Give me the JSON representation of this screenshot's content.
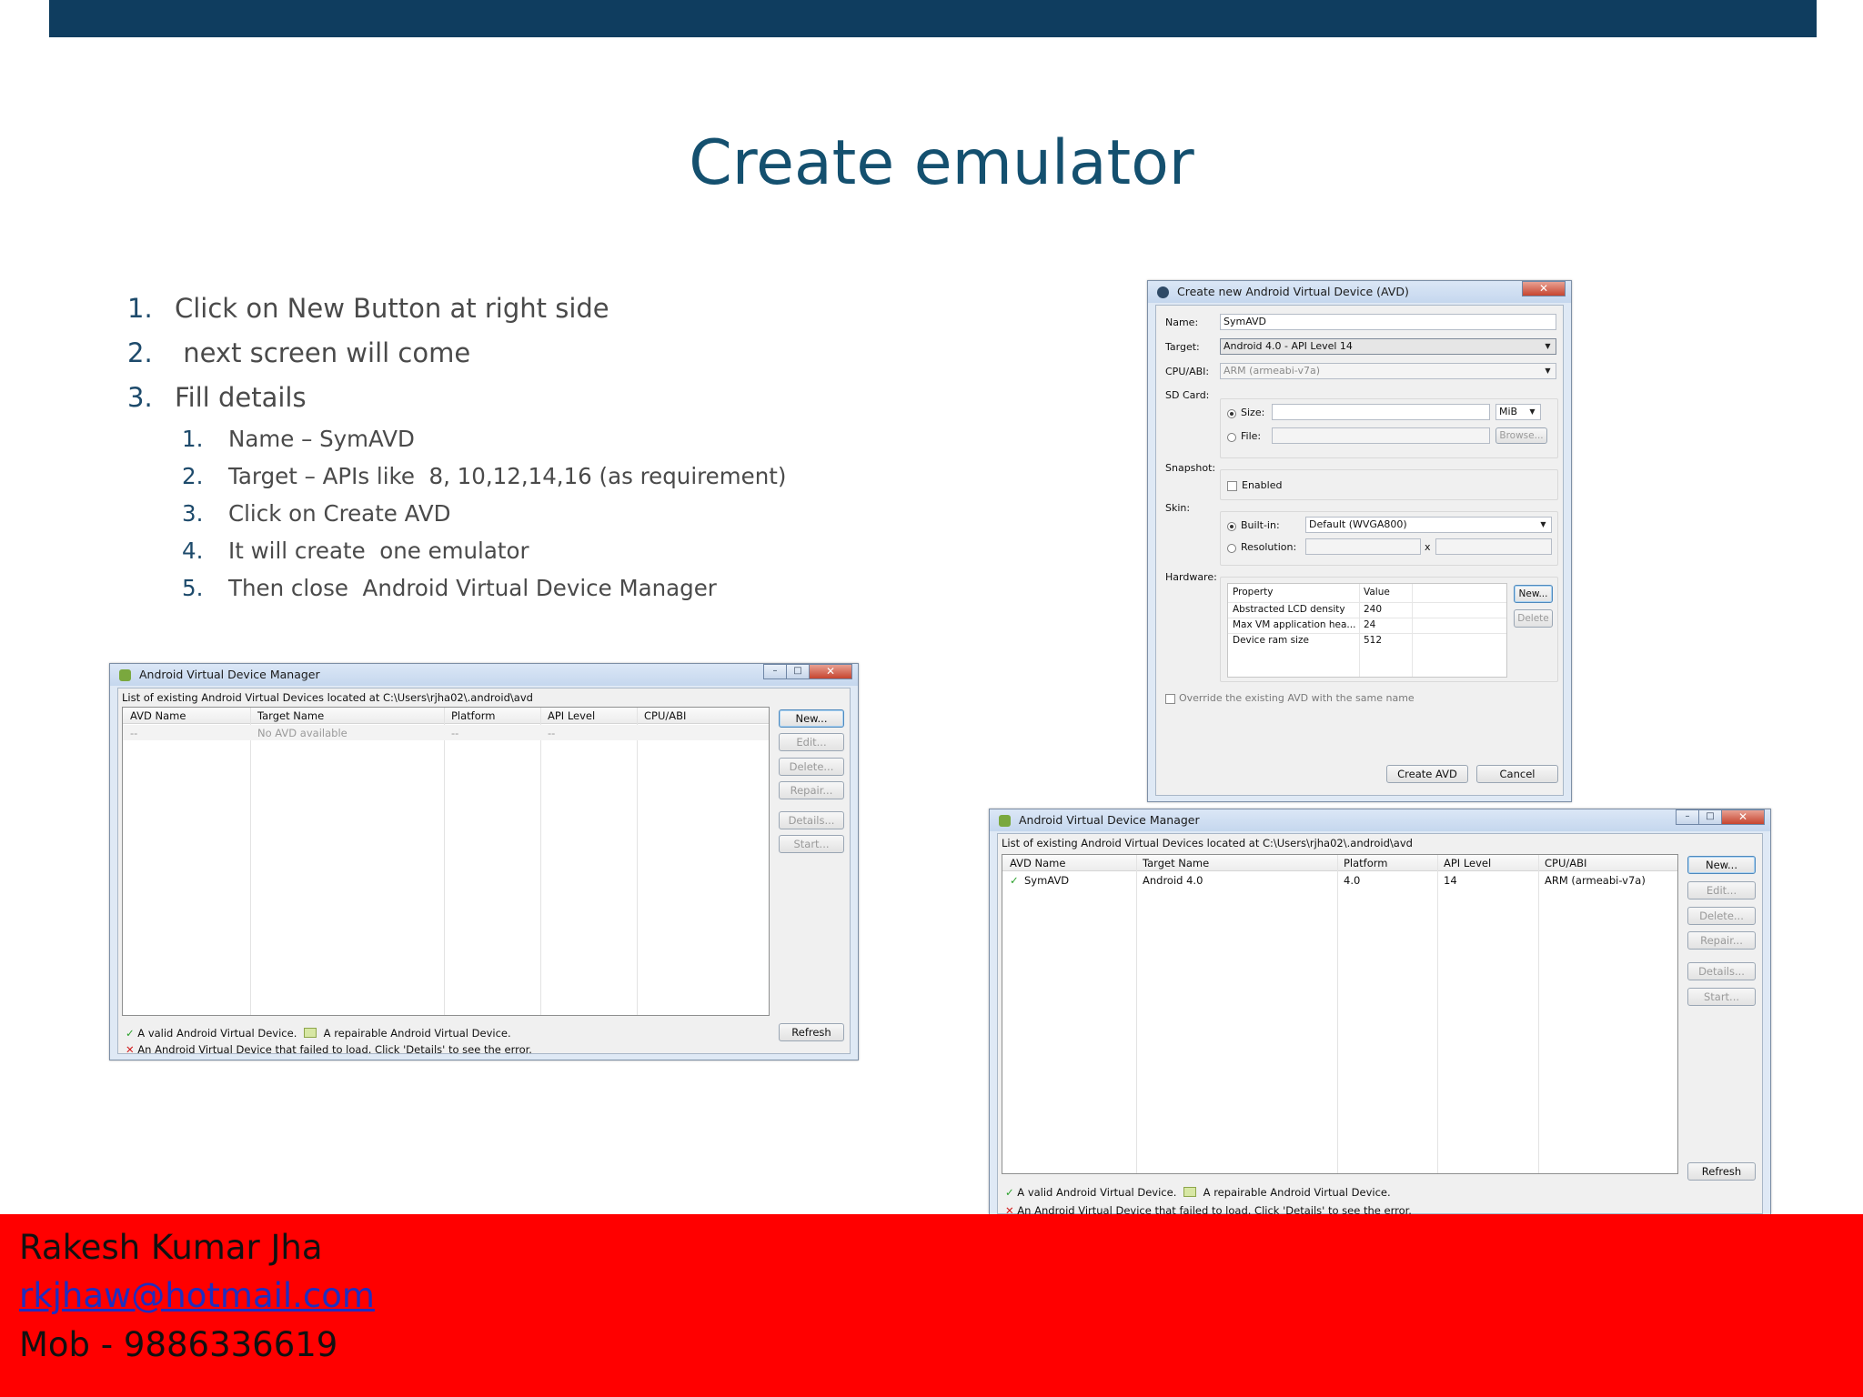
{
  "slide": {
    "title": "Create emulator",
    "steps": [
      {
        "num": "1.",
        "text": "Click on New Button at right side"
      },
      {
        "num": "2.",
        "text": " next screen will come"
      },
      {
        "num": "3.",
        "text": "Fill details"
      }
    ],
    "substeps": [
      {
        "num": "1.",
        "text": "Name – SymAVD"
      },
      {
        "num": "2.",
        "text": "Target – APIs like  8, 10,12,14,16 (as requirement)"
      },
      {
        "num": "3.",
        "text": "Click on Create AVD"
      },
      {
        "num": "4.",
        "text": "It will create  one emulator"
      },
      {
        "num": "5.",
        "text": "Then close  Android Virtual Device Manager"
      }
    ]
  },
  "avd_manager": {
    "title": "Android Virtual Device Manager",
    "path_label": "List of existing Android Virtual Devices located at C:\\Users\\rjha02\\.android\\avd",
    "columns": [
      "AVD Name",
      "Target Name",
      "Platform",
      "API Level",
      "CPU/ABI"
    ],
    "empty_row": [
      "--",
      "No AVD available",
      "--",
      "--",
      ""
    ],
    "after_row": {
      "name": "SymAVD",
      "target": "Android 4.0",
      "platform": "4.0",
      "api": "14",
      "cpu": "ARM (armeabi-v7a)"
    },
    "buttons": {
      "new": "New...",
      "edit": "Edit...",
      "delete": "Delete...",
      "repair": "Repair...",
      "details": "Details...",
      "start": "Start...",
      "refresh": "Refresh"
    },
    "legend": {
      "valid": "A valid Android Virtual Device.",
      "repairable": "A repairable Android Virtual Device.",
      "failed": "An Android Virtual Device that failed to load. Click 'Details' to see the error."
    },
    "window_buttons": {
      "minimize": "–",
      "maximize": "□",
      "close": "✕"
    }
  },
  "create_avd": {
    "title": "Create new Android Virtual Device (AVD)",
    "labels": {
      "name": "Name:",
      "target": "Target:",
      "cpu": "CPU/ABI:",
      "sdcard": "SD Card:",
      "size": "Size:",
      "file": "File:",
      "snapshot": "Snapshot:",
      "enabled": "Enabled",
      "skin": "Skin:",
      "builtin": "Built-in:",
      "resolution": "Resolution:",
      "x": "x",
      "hardware": "Hardware:",
      "property": "Property",
      "value": "Value",
      "override": "Override the existing AVD with the same name"
    },
    "values": {
      "name": "SymAVD",
      "target": "Android 4.0 - API Level 14",
      "cpu": "ARM (armeabi-v7a)",
      "size_unit": "MiB",
      "skin": "Default (WVGA800)"
    },
    "hardware_rows": [
      {
        "property": "Abstracted LCD density",
        "value": "240"
      },
      {
        "property": "Max VM application hea...",
        "value": "24"
      },
      {
        "property": "Device ram size",
        "value": "512"
      }
    ],
    "buttons": {
      "browse": "Browse...",
      "new": "New...",
      "delete": "Delete",
      "create": "Create AVD",
      "cancel": "Cancel"
    }
  },
  "footer": {
    "name": "Rakesh Kumar Jha",
    "email": "rkjhaw@hotmail.com",
    "mobile": "Mob - 9886336619"
  },
  "colors": {
    "top_bar": "#0f3d5f",
    "title": "#14506f",
    "footer_bg": "#ff0000",
    "link": "#1f2fbf"
  }
}
